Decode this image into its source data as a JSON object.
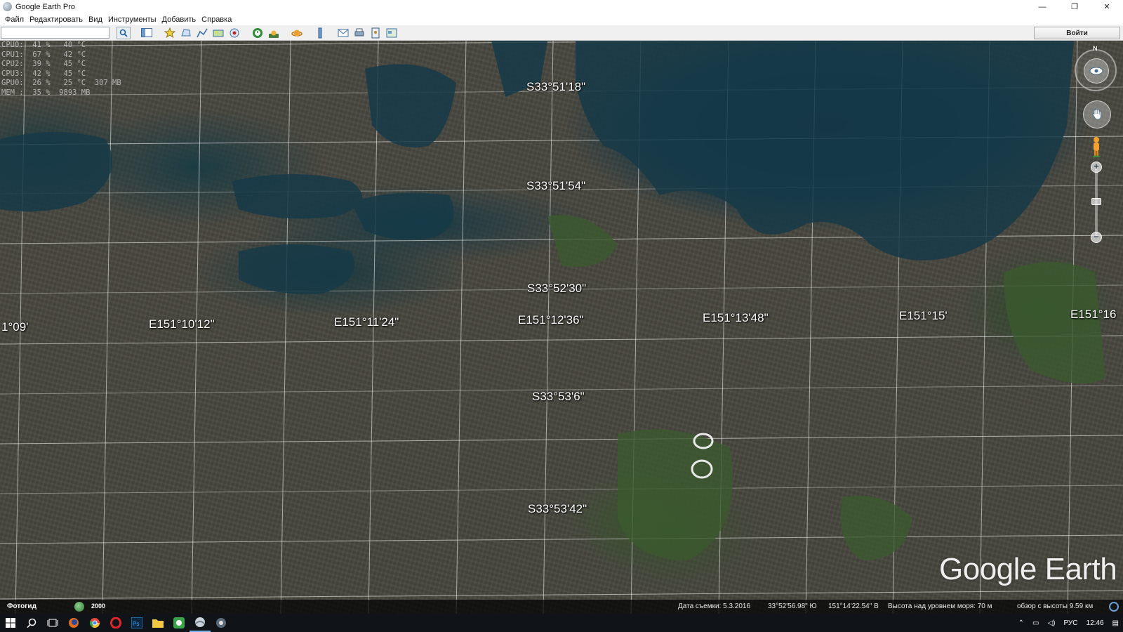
{
  "window": {
    "title": "Google Earth Pro",
    "minimize": "—",
    "maximize": "❐",
    "close": "✕"
  },
  "menu": [
    "Файл",
    "Редактировать",
    "Вид",
    "Инструменты",
    "Добавить",
    "Справка"
  ],
  "toolbar": {
    "search_value": "",
    "signin_label": "Войти"
  },
  "hud": [
    "CPU0:  41 %   40 °C",
    "CPU1:  67 %   42 °C",
    "CPU2:  39 %   45 °C",
    "CPU3:  42 %   45 °C",
    "GPU0:  26 %   25 °C  307 MB",
    "MEM :  35 %  9893 MB"
  ],
  "grid_labels": {
    "latitudes": [
      "S33°51'18\"",
      "S33°51'54\"",
      "S33°52'30\"",
      "S33°53'6\"",
      "S33°53'42\""
    ],
    "longitudes": [
      "1°09'",
      "E151°10'12\"",
      "E151°11'24\"",
      "E151°12'36\"",
      "E151°13'48\"",
      "E151°15'",
      "E151°16"
    ]
  },
  "nav": {
    "north": "N"
  },
  "logo": "Google Earth",
  "statusbar": {
    "tour_label": "Фотогид",
    "year": "2000",
    "imagery_date": "Дата съемки: 5.3.2016",
    "lat": "33°52'56.98\" Ю",
    "lon": "151°14'22.54\" В",
    "elevation": "Высота над уровнем моря:   70 м",
    "eye_alt": "обзор с высоты   9.59 км"
  },
  "taskbar": {
    "lang": "РУС",
    "time": "12:46"
  },
  "colors": {
    "water": "#143746",
    "urban": "#4b4a42",
    "grid": "#ffffff"
  }
}
